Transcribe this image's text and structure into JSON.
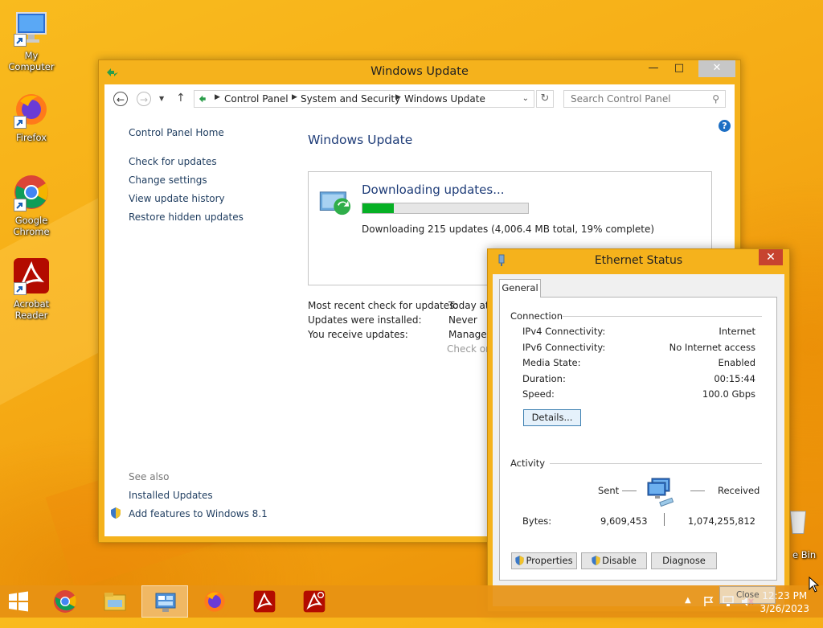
{
  "desktop": {
    "icons": [
      {
        "label": "My Computer"
      },
      {
        "label": "Firefox"
      },
      {
        "label": "Google Chrome"
      },
      {
        "label": "Acrobat Reader"
      }
    ],
    "recycle_bin_label": "e Bin"
  },
  "update_window": {
    "title": "Windows Update",
    "breadcrumb": [
      "Control Panel",
      "System and Security",
      "Windows Update"
    ],
    "search_placeholder": "Search Control Panel",
    "left_nav": {
      "home": "Control Panel Home",
      "links": [
        "Check for updates",
        "Change settings",
        "View update history",
        "Restore hidden updates"
      ],
      "see_also": "See also",
      "see_also_links": [
        "Installed Updates",
        "Add features to Windows 8.1"
      ]
    },
    "heading": "Windows Update",
    "download": {
      "title": "Downloading updates...",
      "progress_percent": 19,
      "info": "Downloading 215 updates (4,006.4 MB total, 19% complete)"
    },
    "status_rows": [
      {
        "label": "Most recent check for updates:",
        "value": "Today at"
      },
      {
        "label": "Updates were installed:",
        "value": "Never"
      },
      {
        "label": "You receive updates:",
        "value": "Managed"
      }
    ],
    "status_extra": "Check on"
  },
  "ethernet_window": {
    "title": "Ethernet Status",
    "tab": "General",
    "connection_label": "Connection",
    "connection": [
      {
        "key": "IPv4 Connectivity:",
        "value": "Internet"
      },
      {
        "key": "IPv6 Connectivity:",
        "value": "No Internet access"
      },
      {
        "key": "Media State:",
        "value": "Enabled"
      },
      {
        "key": "Duration:",
        "value": "00:15:44"
      },
      {
        "key": "Speed:",
        "value": "100.0 Gbps"
      }
    ],
    "details_button": "Details...",
    "activity_label": "Activity",
    "sent_label": "Sent",
    "received_label": "Received",
    "bytes_label": "Bytes:",
    "bytes_sent": "9,609,453",
    "bytes_received": "1,074,255,812",
    "buttons": {
      "properties": "Properties",
      "disable": "Disable",
      "diagnose": "Diagnose"
    },
    "close_tooltip": "Close"
  },
  "taskbar": {
    "time": "12:23 PM",
    "date": "3/26/2023"
  }
}
